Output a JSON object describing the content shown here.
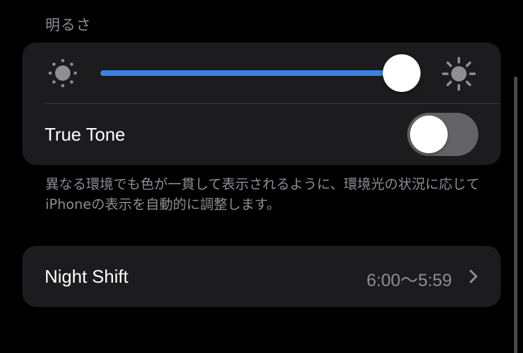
{
  "brightness": {
    "header": "明るさ",
    "level": 0.94,
    "accent_color": "#3b82e0",
    "min_icon": "sun-small-icon",
    "max_icon": "sun-large-icon"
  },
  "true_tone": {
    "label": "True Tone",
    "enabled": false,
    "description": "異なる環境でも色が一貫して表示されるように、環境光の状況に応じてiPhoneの表示を自動的に調整します。"
  },
  "night_shift": {
    "label": "Night Shift",
    "value": "6:00〜5:59",
    "chevron_icon": "chevron-right-icon"
  }
}
